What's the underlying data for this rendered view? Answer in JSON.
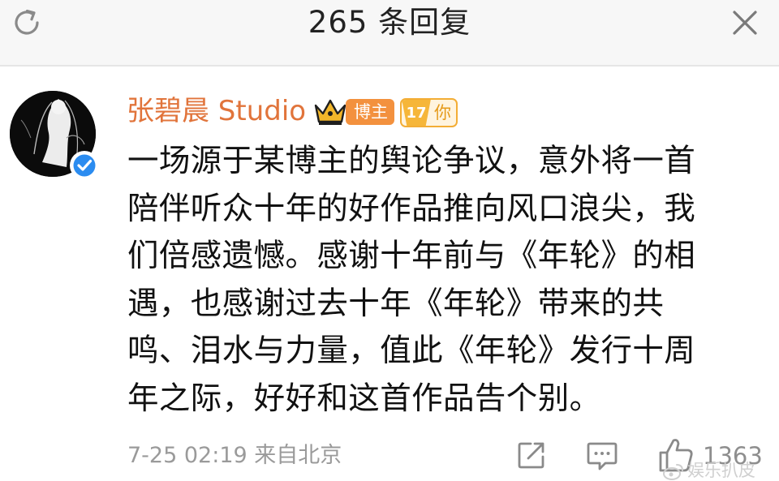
{
  "header": {
    "title": "265 条回复",
    "refresh_icon": "refresh-icon",
    "close_icon": "close-icon"
  },
  "post": {
    "author": {
      "name": "张碧晨 Studio",
      "avatar": "avatar",
      "verified_icon": "verified-badge-icon",
      "crown_icon": "crown-icon",
      "role_badge": "博主",
      "fan_level": "17",
      "fan_label": "你"
    },
    "body_lines": [
      "一场源于某博主的舆论争议，意外将一首",
      "陪伴听众十年的好作品推向风口浪尖，我",
      "们倍感遗憾。感谢十年前与《年轮》的相",
      "遇，也感谢过去十年《年轮》带来的共",
      "鸣、泪水与力量，值此《年轮》发行十周",
      "年之际，好好和这首作品告个别。"
    ],
    "meta": "7-25 02:19 来自北京",
    "actions": {
      "share_icon": "share-icon",
      "comment_icon": "comment-icon",
      "like_icon": "like-icon",
      "like_count": "1363"
    }
  },
  "watermark": {
    "icon": "weibo-icon",
    "text": "娱乐扒皮"
  },
  "colors": {
    "header_bg": "#f7f7f7",
    "author_name": "#e1743b",
    "blogger_badge": "#f3913e",
    "fan_badge": "#f3ad35",
    "verified": "#2b8cf0",
    "meta_text": "#9a9a9a"
  }
}
